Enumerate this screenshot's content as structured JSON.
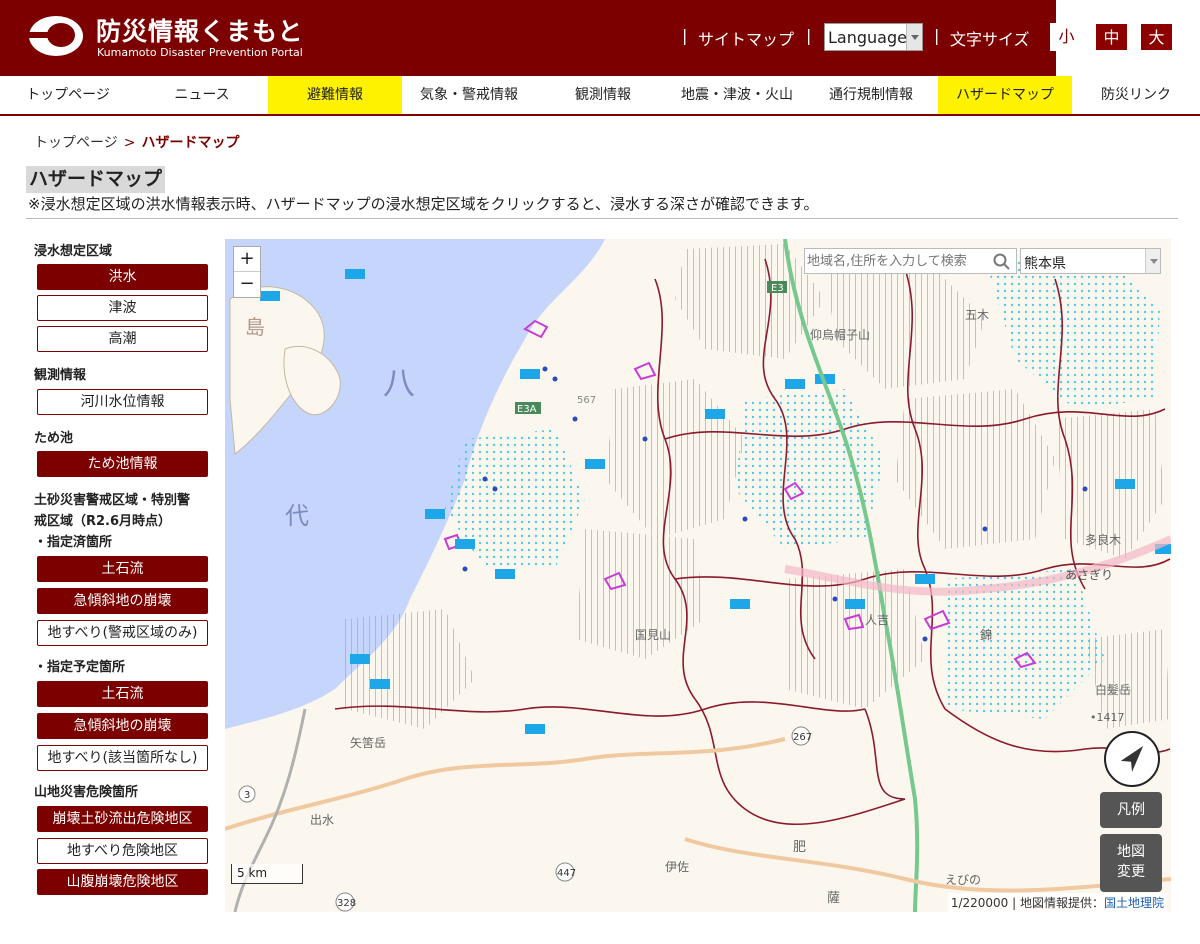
{
  "header": {
    "title": "防災情報くまもと",
    "subtitle": "Kumamoto Disaster Prevention Portal",
    "sitemap": "サイトマップ",
    "language": "Language",
    "font_size_label": "文字サイズ",
    "size_small": "小",
    "size_medium": "中",
    "size_large": "大",
    "separator": "|"
  },
  "nav": [
    "トップページ",
    "ニュース",
    "避難情報",
    "気象・警戒情報",
    "観測情報",
    "地震・津波・火山",
    "通行規制情報",
    "ハザードマップ",
    "防災リンク"
  ],
  "breadcrumb": {
    "home": "トップページ",
    "sep": ">",
    "current": "ハザードマップ"
  },
  "page": {
    "title": "ハザードマップ",
    "note": "※浸水想定区域の洪水情報表示時、ハザードマップの浸水想定区域をクリックすると、浸水する深さが確認できます。"
  },
  "sidebar": {
    "flood_head": "浸水想定区域",
    "flood": "洪水",
    "tsunami": "津波",
    "storm_surge": "高潮",
    "obs_head": "観測情報",
    "river_level": "河川水位情報",
    "pond_head": "ため池",
    "pond_info": "ため池情報",
    "sediment_head_1": "土砂災害警戒区域・特別警",
    "sediment_head_2": "戒区域（R2.6月時点）",
    "designated_head": "・指定済箇所",
    "debris_flow_1": "土石流",
    "steep_slope_1": "急傾斜地の崩壊",
    "landslide_1": "地すべり(警戒区域のみ)",
    "planned_head": "・指定予定箇所",
    "debris_flow_2": "土石流",
    "steep_slope_2": "急傾斜地の崩壊",
    "landslide_2": "地すべり(該当箇所なし)",
    "mountain_head": "山地災害危険箇所",
    "collapse_debris": "崩壊土砂流出危険地区",
    "landslide_danger": "地すべり危険地区",
    "slope_collapse": "山腹崩壊危険地区"
  },
  "map": {
    "zoom_in": "+",
    "zoom_out": "−",
    "search_placeholder": "地域名,住所を入力して検索",
    "prefecture": "熊本県",
    "scale_label": "5 km",
    "attribution_prefix": "1/220000 | 地図情報提供：",
    "attribution_link": "国土地理院",
    "legend_button": "凡例",
    "map_change_1": "地図",
    "map_change_2": "変更",
    "place_labels": [
      "八",
      "代",
      "島",
      "あさぎり",
      "錦",
      "五木",
      "人吉",
      "出水",
      "伊佐",
      "えびの",
      "肥",
      "薩",
      "矢筈岳",
      "国見山",
      "白髪岳",
      "多良木",
      "仰烏帽子山",
      "•1417"
    ],
    "road_labels": [
      "E3",
      "E3A",
      "3",
      "267",
      "447",
      "328",
      "567"
    ]
  },
  "colors": {
    "brand": "#7c0000",
    "nav_highlight": "#fff200",
    "sea": "#c6d5fb",
    "flood_zone": "#3fc6e6",
    "boundary": "#8b1a2e"
  }
}
